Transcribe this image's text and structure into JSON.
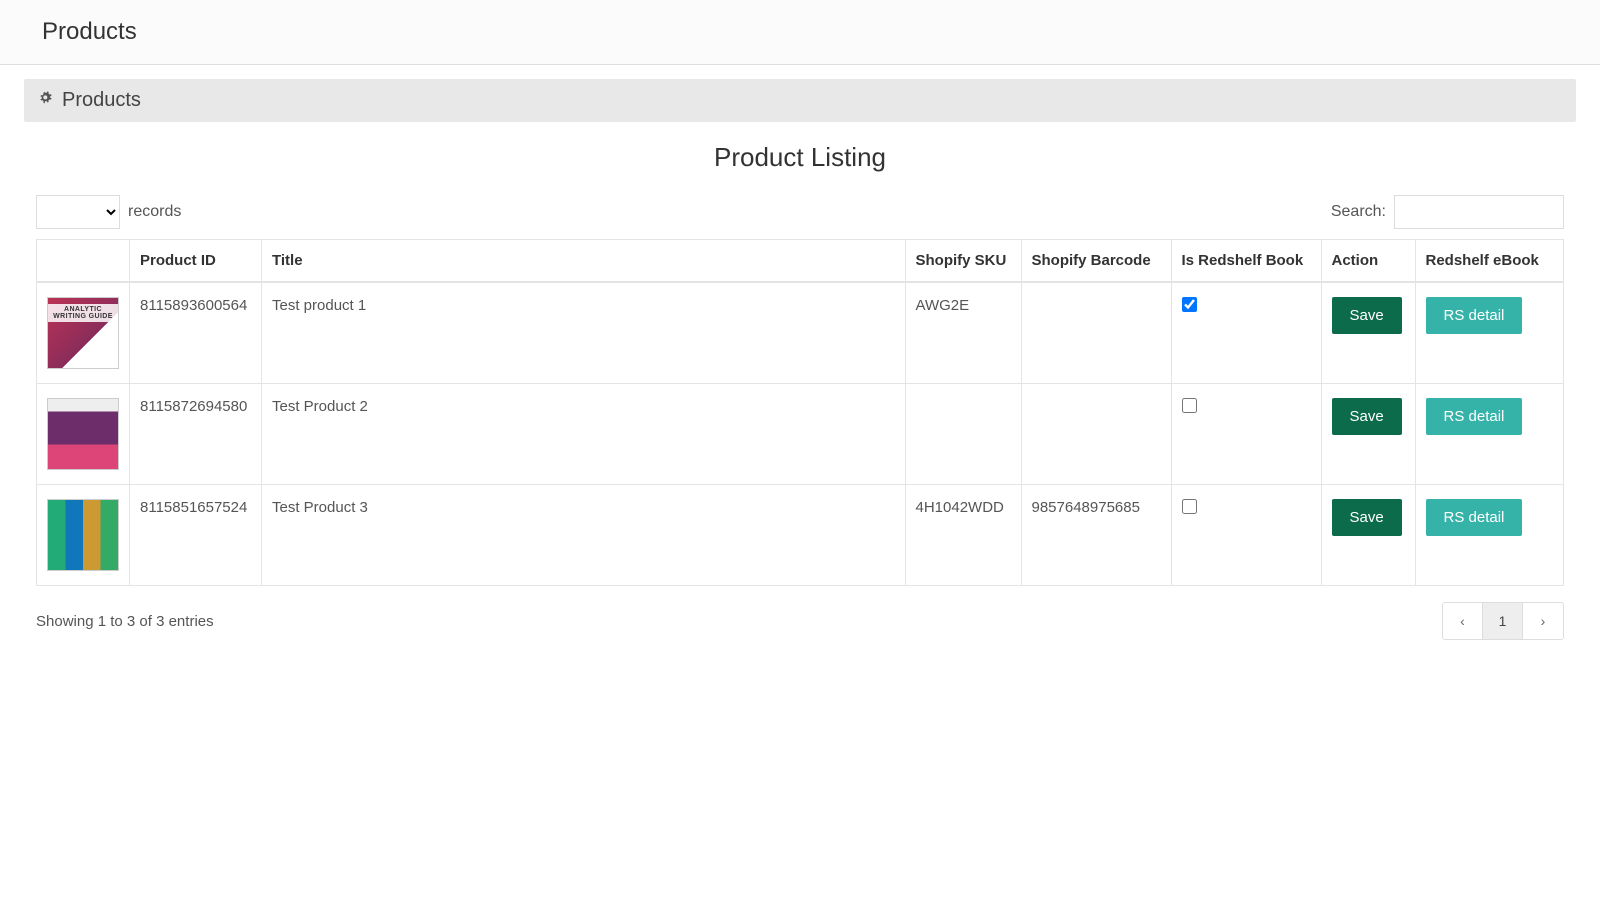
{
  "header": {
    "title": "Products"
  },
  "panel": {
    "title": "Products"
  },
  "listing": {
    "title": "Product Listing"
  },
  "controls": {
    "records_label": "records",
    "search_label": "Search:"
  },
  "columns": {
    "image": "",
    "product_id": "Product ID",
    "title": "Title",
    "shopify_sku": "Shopify SKU",
    "shopify_barcode": "Shopify Barcode",
    "is_redshelf": "Is Redshelf Book",
    "action": "Action",
    "redshelf_ebook": "Redshelf eBook"
  },
  "rows": [
    {
      "thumb_caption": "ANALYTIC WRITING GUIDE",
      "product_id": "8115893600564",
      "title": "Test product 1",
      "shopify_sku": "AWG2E",
      "shopify_barcode": "",
      "is_redshelf": true
    },
    {
      "thumb_caption": "",
      "product_id": "8115872694580",
      "title": "Test Product 2",
      "shopify_sku": "",
      "shopify_barcode": "",
      "is_redshelf": false
    },
    {
      "thumb_caption": "",
      "product_id": "8115851657524",
      "title": "Test Product 3",
      "shopify_sku": "4H1042WDD",
      "shopify_barcode": "9857648975685",
      "is_redshelf": false
    }
  ],
  "buttons": {
    "save": "Save",
    "rs_detail": "RS detail"
  },
  "footer": {
    "entries": "Showing 1 to 3 of 3 entries",
    "page": "1"
  }
}
